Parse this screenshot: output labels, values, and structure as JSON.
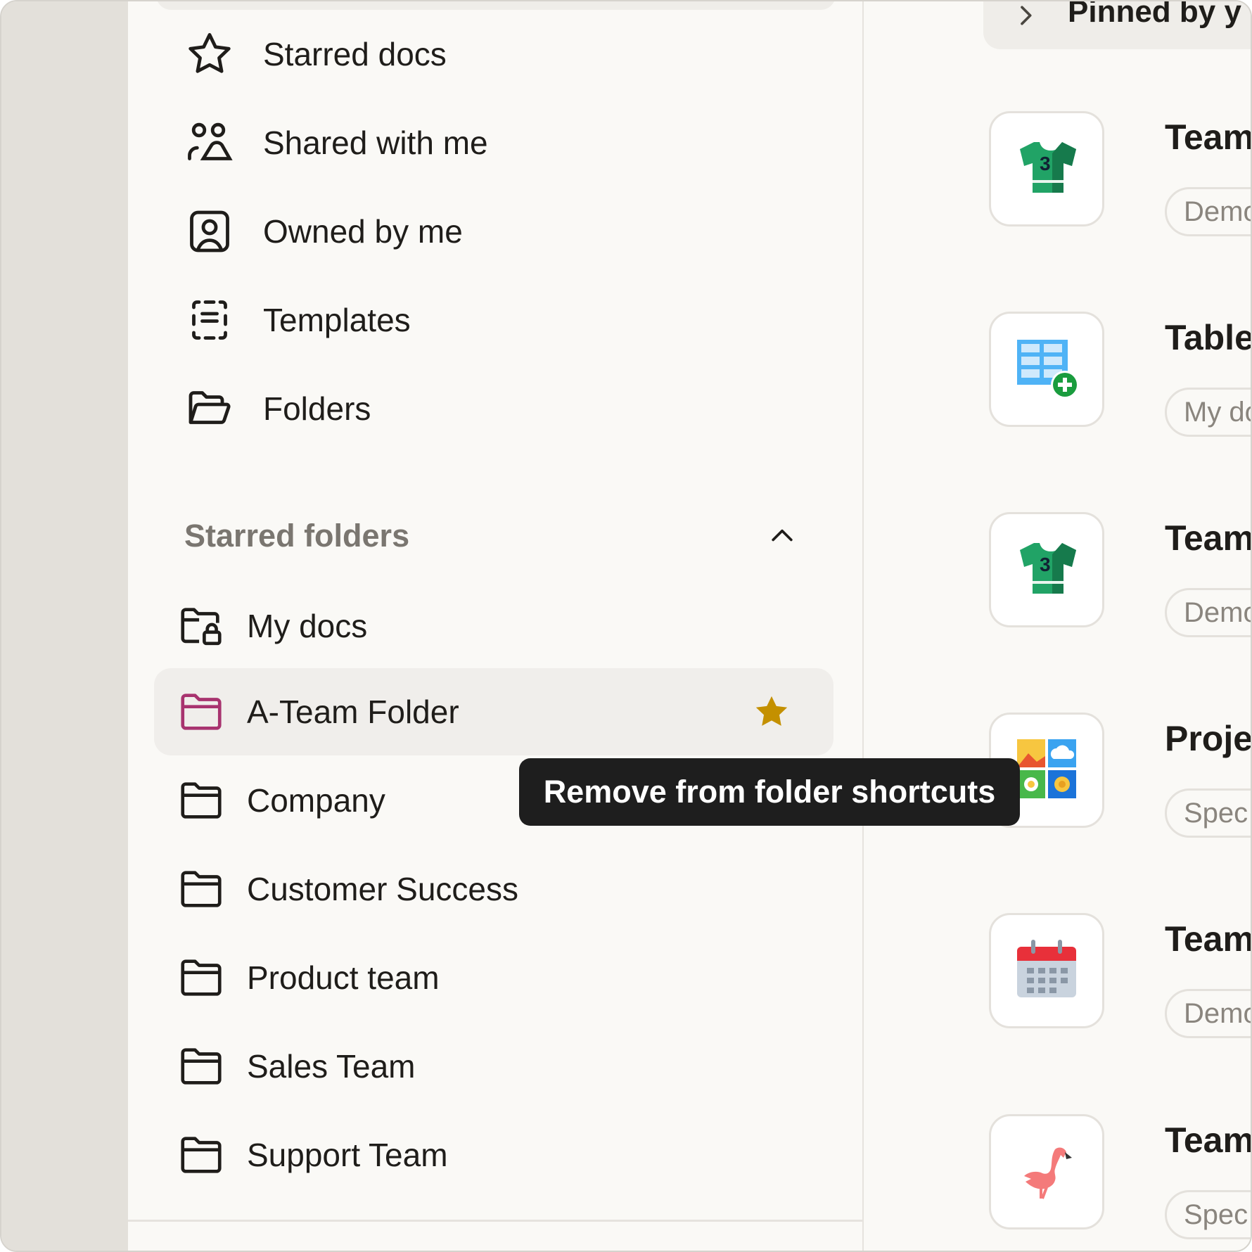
{
  "nav": {
    "items": [
      {
        "label": "Starred docs",
        "icon": "star-outline-icon"
      },
      {
        "label": "Shared with me",
        "icon": "people-icon"
      },
      {
        "label": "Owned by me",
        "icon": "person-badge-icon"
      },
      {
        "label": "Templates",
        "icon": "template-icon"
      },
      {
        "label": "Folders",
        "icon": "folder-open-icon"
      }
    ]
  },
  "starred_folders": {
    "title": "Starred folders",
    "items": [
      {
        "label": "My docs",
        "icon": "folder-lock-icon"
      },
      {
        "label": "A-Team Folder",
        "icon": "folder-icon",
        "active": true,
        "starred": true,
        "icon_color": "#a8336f"
      },
      {
        "label": "Company",
        "icon": "folder-icon"
      },
      {
        "label": "Customer Success",
        "icon": "folder-icon"
      },
      {
        "label": "Product team",
        "icon": "folder-icon"
      },
      {
        "label": "Sales Team",
        "icon": "folder-icon"
      },
      {
        "label": "Support Team",
        "icon": "folder-icon"
      }
    ]
  },
  "tooltip": {
    "text": "Remove from folder shortcuts"
  },
  "pinned": {
    "header": "Pinned by y",
    "docs": [
      {
        "title": "Team",
        "tag": "Demo",
        "icon": "jersey-icon"
      },
      {
        "title": "Table",
        "tag": "My do",
        "icon": "table-add-icon"
      },
      {
        "title": "Team",
        "tag": "Demo",
        "icon": "jersey-icon"
      },
      {
        "title": "Proje",
        "tag": "Spec",
        "icon": "photo-grid-icon"
      },
      {
        "title": "Team",
        "tag": "Demo",
        "icon": "calendar-icon"
      },
      {
        "title": "Team",
        "tag": "Spec",
        "icon": "flamingo-icon"
      }
    ]
  },
  "colors": {
    "accent_star": "#c49000",
    "active_folder": "#a8336f",
    "sidebar_bg": "#faf9f6"
  }
}
